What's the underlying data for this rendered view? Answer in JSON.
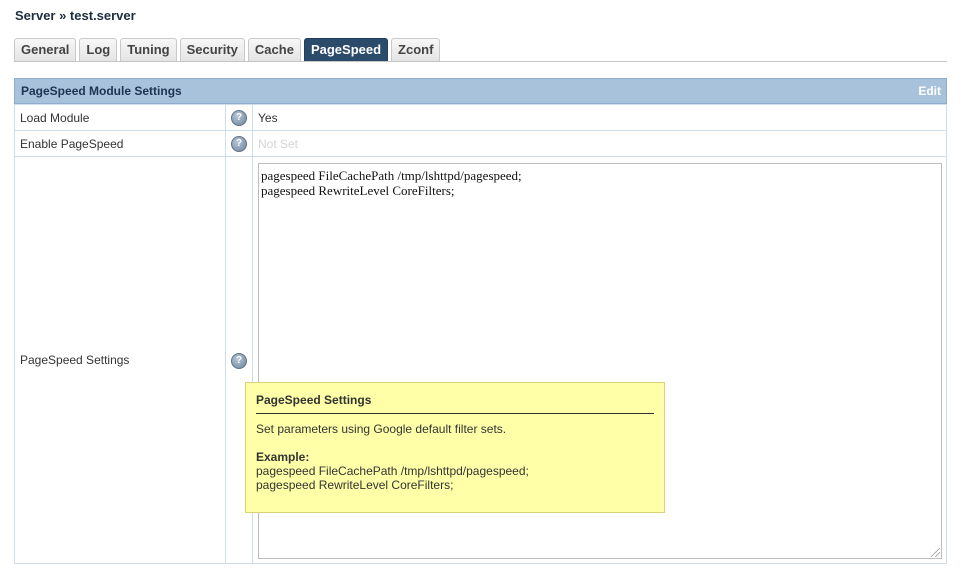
{
  "breadcrumb": "Server » test.server",
  "tabs": [
    {
      "label": "General",
      "active": false
    },
    {
      "label": "Log",
      "active": false
    },
    {
      "label": "Tuning",
      "active": false
    },
    {
      "label": "Security",
      "active": false
    },
    {
      "label": "Cache",
      "active": false
    },
    {
      "label": "PageSpeed",
      "active": true
    },
    {
      "label": "Zconf",
      "active": false
    }
  ],
  "panel": {
    "title": "PageSpeed Module Settings",
    "edit_label": "Edit",
    "rows": [
      {
        "label": "Load Module",
        "value": "Yes"
      },
      {
        "label": "Enable PageSpeed",
        "value": "Not Set"
      },
      {
        "label": "PageSpeed Settings",
        "value": "pagespeed FileCachePath /tmp/lshttpd/pagespeed;\npagespeed RewriteLevel CoreFilters;"
      }
    ]
  },
  "help_icon_glyph": "?",
  "tooltip": {
    "title": "PageSpeed Settings",
    "description": "Set parameters using Google default filter sets.",
    "example_label": "Example:",
    "example_lines": [
      "pagespeed FileCachePath /tmp/lshttpd/pagespeed;",
      "pagespeed RewriteLevel CoreFilters;"
    ]
  },
  "colors": {
    "header_bg": "#a8c2dc",
    "active_tab_bg": "#2b4b6b",
    "tooltip_bg": "#ffffa8"
  }
}
